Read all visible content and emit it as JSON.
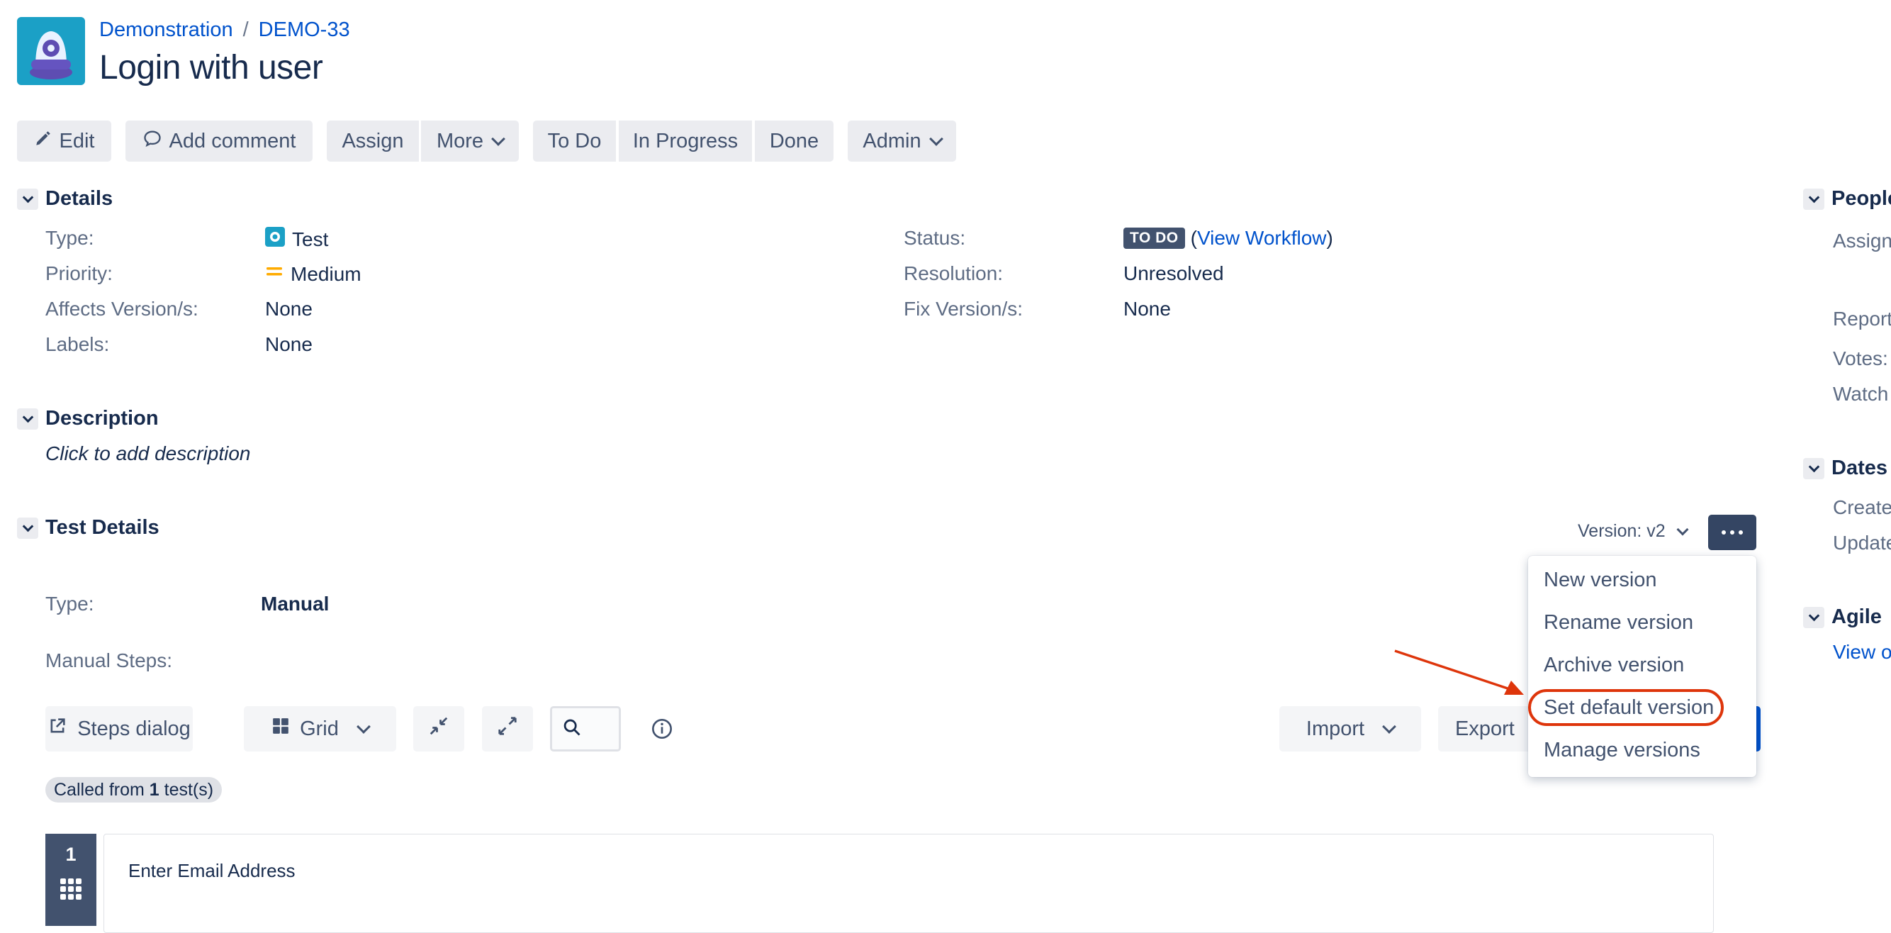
{
  "header": {
    "breadcrumb_project": "Demonstration",
    "breadcrumb_separator": "/",
    "breadcrumb_issue": "DEMO-33",
    "title": "Login with user"
  },
  "toolbar": {
    "edit": "Edit",
    "add_comment": "Add comment",
    "assign": "Assign",
    "more": "More",
    "todo": "To Do",
    "in_progress": "In Progress",
    "done": "Done",
    "admin": "Admin"
  },
  "details": {
    "heading": "Details",
    "type_label": "Type:",
    "type_value": "Test",
    "priority_label": "Priority:",
    "priority_value": "Medium",
    "affects_label": "Affects Version/s:",
    "affects_value": "None",
    "labels_label": "Labels:",
    "labels_value": "None",
    "status_label": "Status:",
    "status_value": "TO DO",
    "status_paren_open": "(",
    "view_workflow": "View Workflow",
    "status_paren_close": ")",
    "resolution_label": "Resolution:",
    "resolution_value": "Unresolved",
    "fix_label": "Fix Version/s:",
    "fix_value": "None"
  },
  "description": {
    "heading": "Description",
    "placeholder": "Click to add description"
  },
  "test_details": {
    "heading": "Test Details",
    "version_label": "Version: v2",
    "type_label": "Type:",
    "type_value": "Manual",
    "manual_steps_label": "Manual Steps:",
    "steps_dialog": "Steps dialog",
    "grid": "Grid",
    "import": "Import",
    "export": "Export",
    "called_from_prefix": "Called from",
    "called_from_count": "1",
    "called_from_suffix": "test(s)",
    "step_number": "1",
    "step_action": "Enter Email Address"
  },
  "version_menu": {
    "items": [
      "New version",
      "Rename version",
      "Archive version",
      "Set default version",
      "Manage versions"
    ],
    "highlight_color": "#de350b"
  },
  "right_panel": {
    "people_heading": "People",
    "assignee_label": "Assign",
    "reporter_label": "Report",
    "votes_label": "Votes:",
    "watchers_label": "Watch",
    "dates_heading": "Dates",
    "created_label": "Create",
    "updated_label": "Update",
    "agile_heading": "Agile",
    "agile_link": "View o"
  },
  "colors": {
    "link": "#0052cc",
    "text": "#172b4d",
    "button_bg": "#ebecf0",
    "primary": "#42526e",
    "medium_priority": "#ffab00",
    "test_icon": "#1ba0c6",
    "annotation_red": "#de350b"
  }
}
